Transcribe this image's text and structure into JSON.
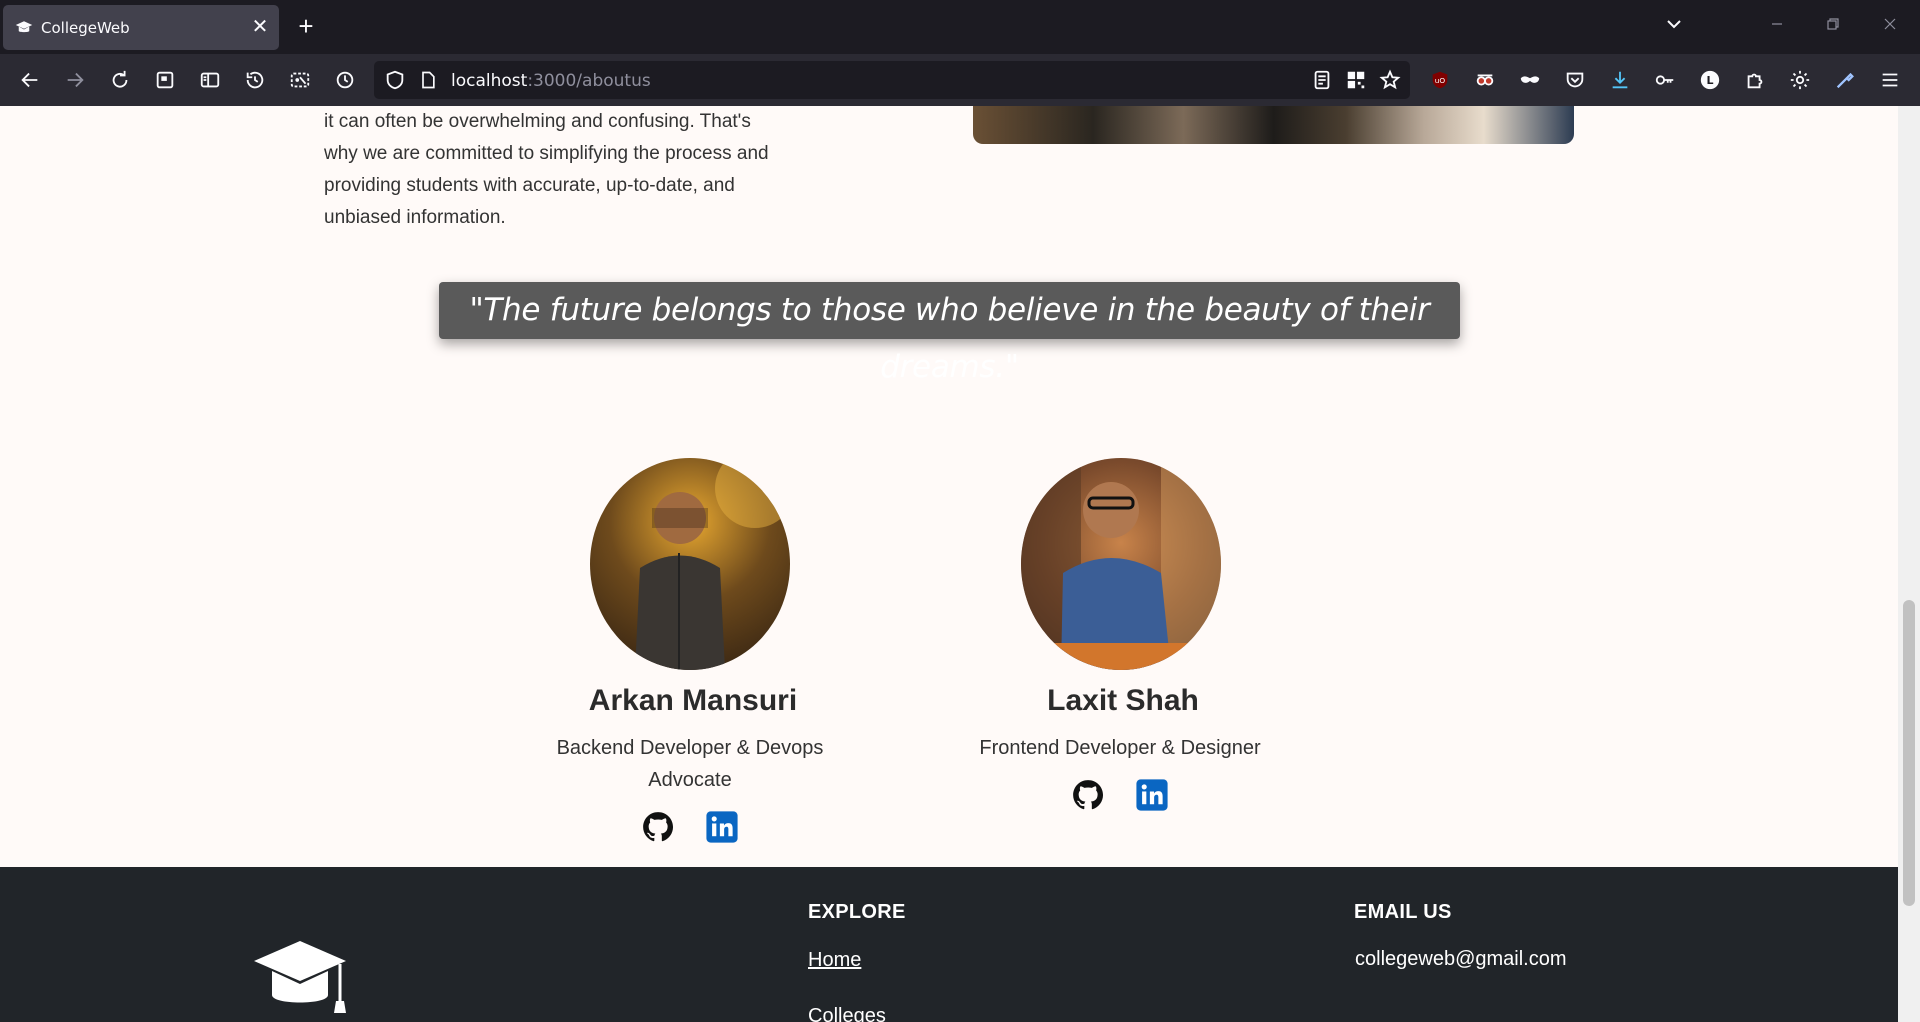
{
  "browser": {
    "tab_title": "CollegeWeb",
    "url_host": "localhost",
    "url_path": ":3000/aboutus"
  },
  "page": {
    "intro_lines": [
      "it can often be overwhelming and confusing. That's",
      "why we are committed to simplifying the process and",
      "providing students with accurate, up-to-date, and",
      "unbiased information."
    ],
    "quote": "\"The future belongs to those who believe in the beauty of their dreams.\"",
    "team": [
      {
        "name": "Arkan Mansuri",
        "role": "Backend Developer & Devops Advocate"
      },
      {
        "name": "Laxit Shah",
        "role": "Frontend Developer & Designer"
      }
    ],
    "footer": {
      "explore_heading": "EXPLORE",
      "links": [
        "Home",
        "Colleges"
      ],
      "email_heading": "EMAIL US",
      "email": "collegeweb@gmail.com"
    }
  },
  "colors": {
    "page_bg": "#fffaf8",
    "quote_bg": "#5a5a5a",
    "footer_bg": "#212529",
    "linkedin_blue": "#0a66c2"
  },
  "icons": [
    "back-icon",
    "forward-icon",
    "reload-icon",
    "github-icon",
    "linkedin-icon",
    "graduation-cap-icon"
  ]
}
